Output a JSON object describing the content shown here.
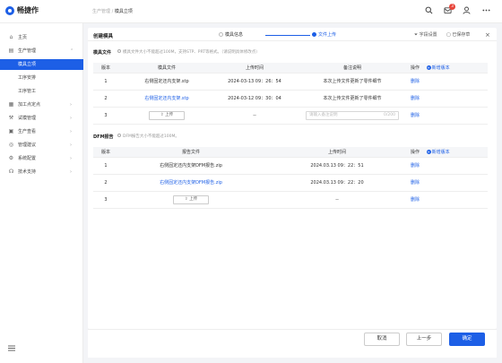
{
  "app": {
    "name": "畅捷作"
  },
  "breadcrumb": {
    "parent": "生产管理",
    "sep": "/",
    "current": "模具立项"
  },
  "topbar": {
    "notification_count": "3"
  },
  "sidebar": {
    "items": [
      {
        "label": "主页",
        "icon": "home-icon",
        "glyph": "⌂",
        "arrow": ""
      },
      {
        "label": "生产管理",
        "icon": "production-icon",
        "glyph": "▤",
        "arrow": "⌃"
      },
      {
        "label": "模具立项",
        "sub": true,
        "active": true
      },
      {
        "label": "工序安排",
        "sub": true
      },
      {
        "label": "工序管工",
        "sub": true
      },
      {
        "label": "加工点定点",
        "icon": "calendar-icon",
        "glyph": "▦",
        "arrow": "›"
      },
      {
        "label": "试模管理",
        "icon": "tool-icon",
        "glyph": "⚒",
        "arrow": "›"
      },
      {
        "label": "生产查看",
        "icon": "view-icon",
        "glyph": "▣",
        "arrow": "›"
      },
      {
        "label": "管理建议",
        "icon": "advice-icon",
        "glyph": "◎",
        "arrow": "›"
      },
      {
        "label": "系统配置",
        "icon": "settings-icon",
        "glyph": "⚙",
        "arrow": "›"
      },
      {
        "label": "技术支持",
        "icon": "support-icon",
        "glyph": "☊",
        "arrow": "›"
      }
    ]
  },
  "card": {
    "title": "创建模具",
    "steps": [
      {
        "label": "模具信息"
      },
      {
        "label": "文件上传"
      }
    ],
    "tools": {
      "field_settings": "字段设置",
      "draft": "已保存草",
      "close": "×"
    }
  },
  "mold_files": {
    "title": "模具文件",
    "tip": "模具文件大小不能超过100M，支持STP、PRT等格式。（请说明具体修改点）",
    "columns": [
      "版本",
      "模具文件",
      "上传时间",
      "备注说明",
      "操作"
    ],
    "add_version": "新增版本",
    "rows": [
      {
        "version": "1",
        "file": "右侧固定还内支架.stp",
        "time": "2024-03-13 09：26：54",
        "note": "本次上传文件更新了零件细节",
        "op": "删除"
      },
      {
        "version": "2",
        "file": "右侧固定还内支架.stp",
        "time": "2024-03-12 09：30：04",
        "note": "本次上传文件更新了零件细节",
        "op": "删除"
      },
      {
        "version": "3",
        "upload": "上传",
        "time": "--",
        "note_placeholder": "请输入备注说明",
        "note_count": "0/200",
        "op": "删除"
      }
    ]
  },
  "dfm": {
    "title": "DFM报告",
    "tip": "DFM报告大小不能超过100M。",
    "columns": [
      "版本",
      "报告文件",
      "上传时间",
      "操作"
    ],
    "add_version": "新增版本",
    "rows": [
      {
        "version": "1",
        "file": "右侧固定还内支架DFM报告.zip",
        "time": "2024.03.13 09：22：51",
        "op": "删除"
      },
      {
        "version": "2",
        "file": "右侧固定还内支架DFM报告.zip",
        "time": "2024.03.13 09：22：20",
        "op": "删除"
      },
      {
        "version": "3",
        "upload": "上传",
        "time": "--",
        "op": "删除"
      }
    ]
  },
  "footer": {
    "cancel": "取消",
    "prev": "上一步",
    "confirm": "确定"
  }
}
